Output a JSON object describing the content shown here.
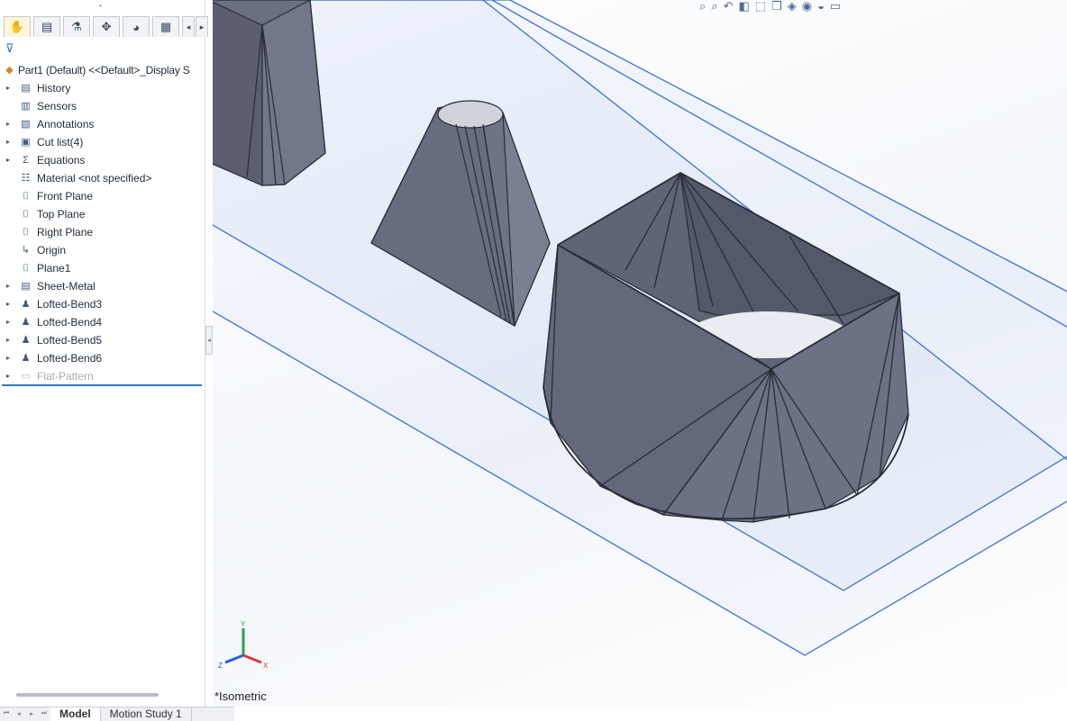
{
  "panel": {
    "tabs": [
      {
        "icon": "feature-manager-icon",
        "glyph": "✋"
      },
      {
        "icon": "property-manager-icon",
        "glyph": "▤"
      },
      {
        "icon": "configuration-manager-icon",
        "glyph": "⚗"
      },
      {
        "icon": "dimxpert-icon",
        "glyph": "✥"
      },
      {
        "icon": "display-manager-icon",
        "glyph": "◕"
      },
      {
        "icon": "cam-icon",
        "glyph": "▦"
      }
    ],
    "filter_glyph": "⊽",
    "root": {
      "label": "Part1 (Default) <<Default>_Display S",
      "icon": "part-icon",
      "glyph": "◆"
    },
    "items": [
      {
        "label": "History",
        "expandable": true,
        "icon": "history-icon",
        "glyph": "▤"
      },
      {
        "label": "Sensors",
        "expandable": false,
        "icon": "sensors-icon",
        "glyph": "▥"
      },
      {
        "label": "Annotations",
        "expandable": true,
        "icon": "annotations-icon",
        "glyph": "▧"
      },
      {
        "label": "Cut list(4)",
        "expandable": true,
        "icon": "cut-list-icon",
        "glyph": "▣"
      },
      {
        "label": "Equations",
        "expandable": true,
        "icon": "equations-icon",
        "glyph": "Σ"
      },
      {
        "label": "Material <not specified>",
        "expandable": false,
        "icon": "material-icon",
        "glyph": "☷"
      },
      {
        "label": "Front Plane",
        "expandable": false,
        "icon": "plane-icon",
        "glyph": "⌷"
      },
      {
        "label": "Top Plane",
        "expandable": false,
        "icon": "plane-icon",
        "glyph": "⌷"
      },
      {
        "label": "Right Plane",
        "expandable": false,
        "icon": "plane-icon",
        "glyph": "⌷"
      },
      {
        "label": "Origin",
        "expandable": false,
        "icon": "origin-icon",
        "glyph": "↳"
      },
      {
        "label": "Plane1",
        "expandable": false,
        "icon": "plane-icon",
        "glyph": "⌷"
      },
      {
        "label": "Sheet-Metal",
        "expandable": true,
        "icon": "sheet-metal-icon",
        "glyph": "▤"
      },
      {
        "label": "Lofted-Bend3",
        "expandable": true,
        "icon": "lofted-bend-icon",
        "glyph": "♟"
      },
      {
        "label": "Lofted-Bend4",
        "expandable": true,
        "icon": "lofted-bend-icon",
        "glyph": "♟"
      },
      {
        "label": "Lofted-Bend5",
        "expandable": true,
        "icon": "lofted-bend-icon",
        "glyph": "♟"
      },
      {
        "label": "Lofted-Bend6",
        "expandable": true,
        "icon": "lofted-bend-icon",
        "glyph": "♟"
      },
      {
        "label": "Flat-Pattern",
        "expandable": true,
        "icon": "flat-pattern-icon",
        "glyph": "▭",
        "suppressed": true
      }
    ]
  },
  "bottom_tabs": [
    "Model",
    "Motion Study 1"
  ],
  "active_bottom_tab": "Model",
  "viewport": {
    "view_label": "*Isometric",
    "triad": {
      "x": "X",
      "y": "Y",
      "z": "Z"
    },
    "headsup_icons": [
      {
        "name": "zoom-to-fit-icon",
        "glyph": "⌕"
      },
      {
        "name": "zoom-to-area-icon",
        "glyph": "⌕"
      },
      {
        "name": "previous-view-icon",
        "glyph": "↶"
      },
      {
        "name": "section-view-icon",
        "glyph": "◧"
      },
      {
        "name": "dynamic-annotation-icon",
        "glyph": "⬚"
      },
      {
        "name": "view-orientation-icon",
        "glyph": "❒"
      },
      {
        "name": "display-style-icon",
        "glyph": "◈"
      },
      {
        "name": "hide-show-items-icon",
        "glyph": "◉"
      },
      {
        "name": "edit-appearance-icon",
        "glyph": "◒"
      },
      {
        "name": "apply-scene-icon",
        "glyph": "▭"
      }
    ]
  },
  "colors": {
    "part": "#6a6f80",
    "part_dark": "#4e5262",
    "plane": "#3f6fd8",
    "rollback": "#2d7bc4"
  }
}
